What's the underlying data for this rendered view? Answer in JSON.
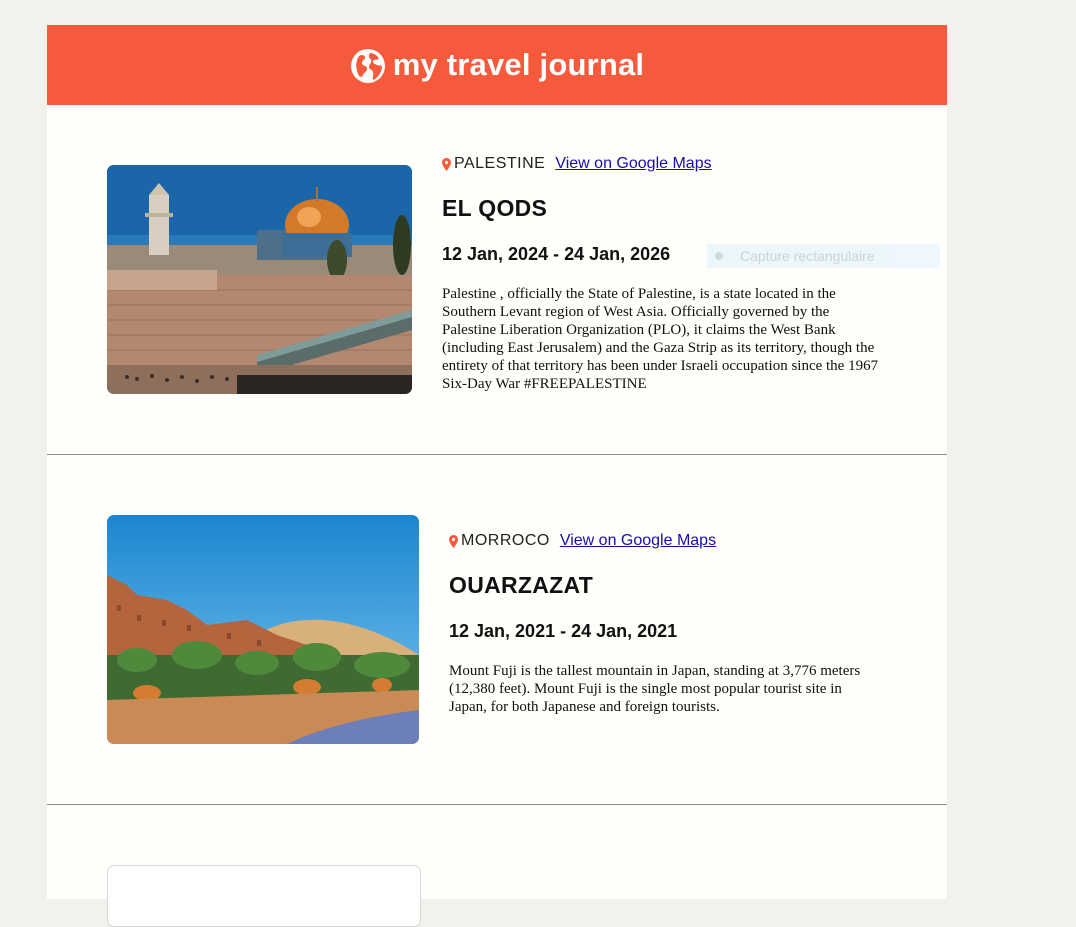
{
  "header": {
    "title": "my travel journal",
    "icon": "globe-icon"
  },
  "overlay": {
    "label": "Capture rectangulaire"
  },
  "entries": [
    {
      "country": "PALESTINE",
      "maps_label": "View on Google Maps",
      "place": "EL QODS",
      "dates": "12 Jan, 2024 - 24 Jan, 2026",
      "description": "Palestine , officially the State of Palestine, is a state located in the Southern Levant region of West Asia. Officially governed by the Palestine Liberation Organization (PLO), it claims the West Bank (including East Jerusalem) and the Gaza Strip as its territory, though the entirety of that territory has been under Israeli occupation since the 1967 Six-Day War #FREEPALESTINE"
    },
    {
      "country": "MORROCO",
      "maps_label": "View on Google Maps",
      "place": "OUARZAZAT",
      "dates": "12 Jan, 2021 - 24 Jan, 2021",
      "description": "Mount Fuji is the tallest mountain in Japan, standing at 3,776 meters (12,380 feet). Mount Fuji is the single most popular tourist site in Japan, for both Japanese and foreign tourists."
    }
  ],
  "colors": {
    "header": "#f55a3c",
    "pin": "#f55a3c",
    "link": "#1a0dab",
    "background": "#f2f1ec"
  }
}
